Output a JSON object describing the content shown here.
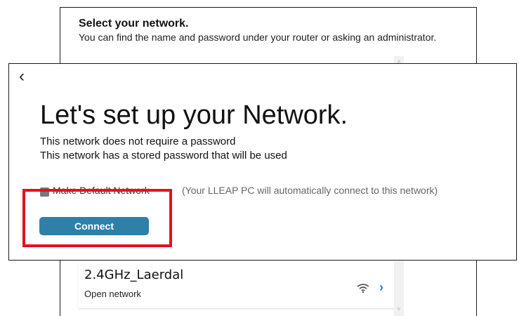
{
  "background_window": {
    "title": "Select your network.",
    "subtitle": "You can find the name and password under your router or asking an administrator.",
    "networks": [
      {
        "name": "2.4GHz_Laerdal",
        "status": "Open network",
        "icon": "wifi-icon"
      }
    ],
    "scroll_up": "˄",
    "scroll_down": "˅"
  },
  "dialog": {
    "back_label": "‹",
    "title": "Let's set up your Network.",
    "info_lines": [
      "This network does not require a password",
      "This network has a stored password that will be used"
    ],
    "checkbox_label": "Make Default Network",
    "checkbox_note": "(Your LLEAP PC will automatically connect to this network)",
    "connect_label": "Connect"
  },
  "colors": {
    "accent": "#2f7fa8",
    "chevron": "#2f79b5",
    "highlight": "#e8101c"
  }
}
